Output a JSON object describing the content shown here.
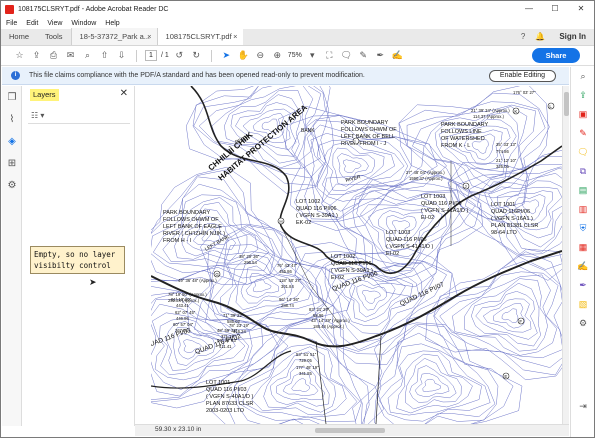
{
  "window": {
    "title": "108175CLSRYT.pdf - Adobe Acrobat Reader DC",
    "minimize": "—",
    "maximize": "☐",
    "close": "✕"
  },
  "menu": [
    "File",
    "Edit",
    "View",
    "Window",
    "Help"
  ],
  "tabs": {
    "home": "Home",
    "tools": "Tools",
    "doc1": "18-5-37372_Park a...",
    "doc2": "108175CLSRYT.pdf",
    "close": "×",
    "sign_in": "Sign In",
    "help": "?",
    "bell": "🔔"
  },
  "toolbar": {
    "page_current": "1",
    "page_total": "/ 1",
    "zoom": "75%",
    "share": "Share"
  },
  "notice": {
    "message": "This file claims compliance with the PDF/A standard and has been opened read-only to prevent modification.",
    "button": "Enable Editing"
  },
  "layers": {
    "title": "Layers",
    "note_lines": [
      "Empty, so no layer",
      "visibilty control"
    ]
  },
  "status": {
    "dimensions": "59.30 x 23.10 in"
  },
  "map": {
    "area_label": [
      "CHHILIIÌ CHIIK",
      "HABITAT PROTECTION AREA"
    ],
    "texts": [
      {
        "id": "pb1",
        "lines": [
          "PARK BOUNDARY",
          "FOLLOWS OHWM OF",
          "LEFT BANK OF BELL",
          "RIVER  FROM I - J"
        ]
      },
      {
        "id": "pb2",
        "lines": [
          "PARK BOUNDARY",
          "FOLLOWS LINE",
          "OF WATERSHED",
          "FROM K - L"
        ]
      },
      {
        "id": "pb3",
        "lines": [
          "PARK BOUNDARY",
          "FOLLOWS OHWM OF",
          "LEFT BANK OF EAGLE",
          "RIVER ( CHʼIZHĪN NJIK )",
          "FROM H - I"
        ]
      },
      {
        "id": "lot1002a",
        "lines": [
          "LOT 1002",
          "QUAD 116 PI/06",
          "( VGFN S-39A1 )",
          "EK-02"
        ]
      },
      {
        "id": "lot1003a",
        "lines": [
          "LOT 1003",
          "QUAD 116 PI/06",
          "( VGFN S-41A1/D )",
          "EI-02"
        ]
      },
      {
        "id": "lot1001a",
        "lines": [
          "LOT 1001",
          "QUAD 116PI/06",
          "( VGFN S-16A1 )",
          "PLAN 81381 CLSR",
          "98-64 LTO"
        ]
      },
      {
        "id": "lot1003b",
        "lines": [
          "LOT 1003",
          "QUAD 116 PI/06",
          "( VGFN S-41A1/D )",
          "EI-02"
        ]
      },
      {
        "id": "lot1002b",
        "lines": [
          "LOT 1002",
          "QUAD 116 PI/06",
          "( VGFN S-39A1 )",
          "EI-02"
        ]
      },
      {
        "id": "lot1001b",
        "lines": [
          "LOT 1001",
          "QUAD 116 PI/03",
          "( VGFN S-40A1/D )",
          "PLAN 87633 CLSR",
          "2003-0203 LTO"
        ]
      }
    ],
    "quads": [
      "QUAD 116 PI/06",
      "QUAD 116 PI/07",
      "QUAD 116 PI/03",
      "QUAD 116 PI/02"
    ],
    "rivers": [
      "RIVER",
      "RIVER",
      "LEFT BANK",
      "BANK"
    ],
    "bearings": [
      "176° 03' 27\"",
      "21° 39' 34\" (Approx.)",
      "114.37 (Approx.)",
      "35° 33' 13\"",
      "774.86",
      "21° 12' 10\"",
      "325.05",
      "27° 48' 04\" (Approx.)",
      "1590.47 (Approx.)",
      "49° 36' 48\" (Approx.)",
      "38° 20' 36\"",
      "296.54",
      "76° 43' 47\"",
      "455.86",
      "118° 50' 27\"",
      "301.84",
      "78° 19' 50\" (Approx.)",
      "251.84 (Approx.)",
      "81° 18' 80\"",
      "443.41",
      "62° 07' 45\"",
      "446.86",
      "60° 57' 04\"",
      "267.56",
      "96° 14' 36\"",
      "288.74",
      "83° 21' 29\"",
      "58.96",
      "43° 14' 29\" (Approx.)",
      "188.48 (Approx.)",
      "48° 59' 32\"",
      "371.17",
      "71° 39' 22\"",
      "585.02",
      "78° 23' 19\"",
      "416.24",
      "86° 26' 53\"",
      "411.41",
      "53° 51' 51\"",
      "729.05",
      "177° 48' 19\"",
      "341.85"
    ],
    "points": [
      "G",
      "H",
      "I",
      "J",
      "K",
      "L",
      "F",
      "E"
    ]
  }
}
